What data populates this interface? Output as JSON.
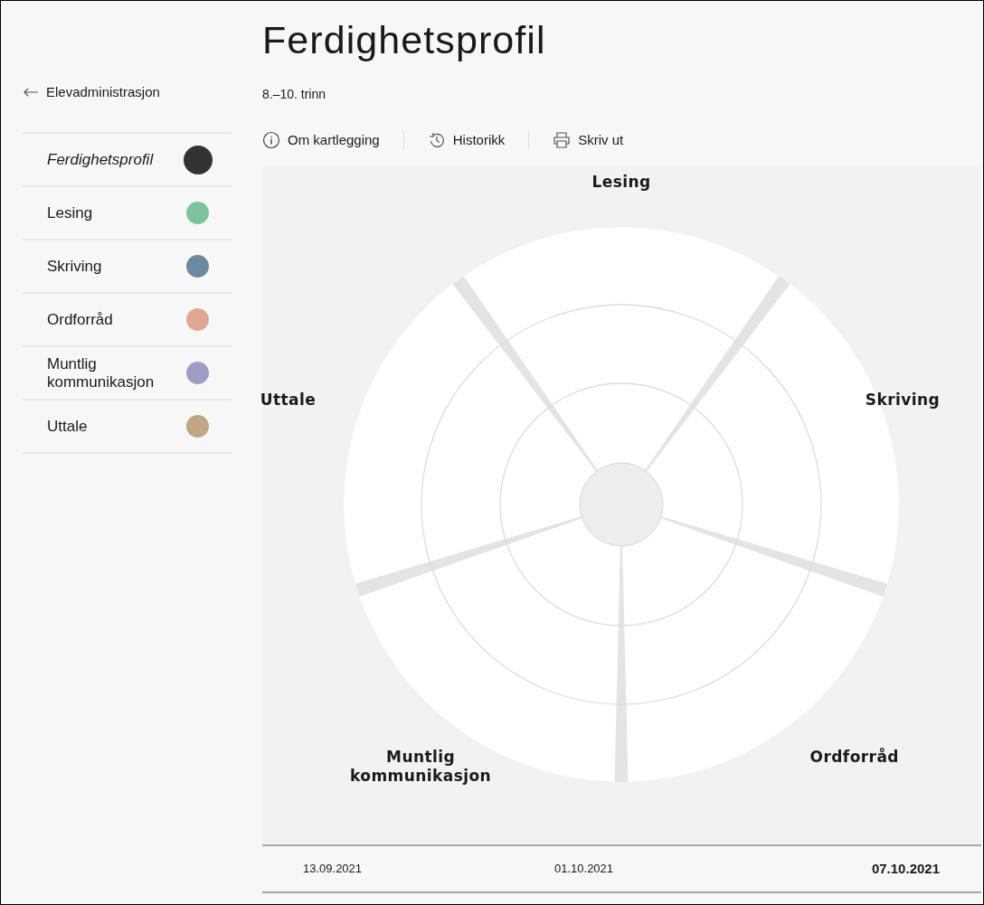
{
  "back_link": {
    "label": "Elevadministrasjon"
  },
  "sidebar": {
    "items": [
      {
        "label": "Ferdighetsprofil",
        "selected": true,
        "color": "#333333"
      },
      {
        "label": "Lesing",
        "selected": false,
        "color": "#7dc29e"
      },
      {
        "label": "Skriving",
        "selected": false,
        "color": "#6b8aa0"
      },
      {
        "label": "Ordforråd",
        "selected": false,
        "color": "#e0a892"
      },
      {
        "label": "Muntlig kommunikasjon",
        "selected": false,
        "color": "#9e9ec4"
      },
      {
        "label": "Uttale",
        "selected": false,
        "color": "#c0a684"
      }
    ]
  },
  "title": "Ferdighetsprofil",
  "subtitle": "8.–10. trinn",
  "toolbar": [
    {
      "kind": "info",
      "label": "Om kartlegging"
    },
    {
      "kind": "history",
      "label": "Historikk"
    },
    {
      "kind": "print",
      "label": "Skriv ut"
    }
  ],
  "wheel": {
    "segments": [
      {
        "label": "Lesing"
      },
      {
        "label": "Skriving"
      },
      {
        "label": "Ordforråd"
      },
      {
        "label": "Muntlig kommunikasjon"
      },
      {
        "label": "Uttale"
      }
    ]
  },
  "dates": [
    {
      "label": "13.09.2021",
      "selected": false
    },
    {
      "label": "01.10.2021",
      "selected": false
    },
    {
      "label": "07.10.2021",
      "selected": true
    }
  ]
}
